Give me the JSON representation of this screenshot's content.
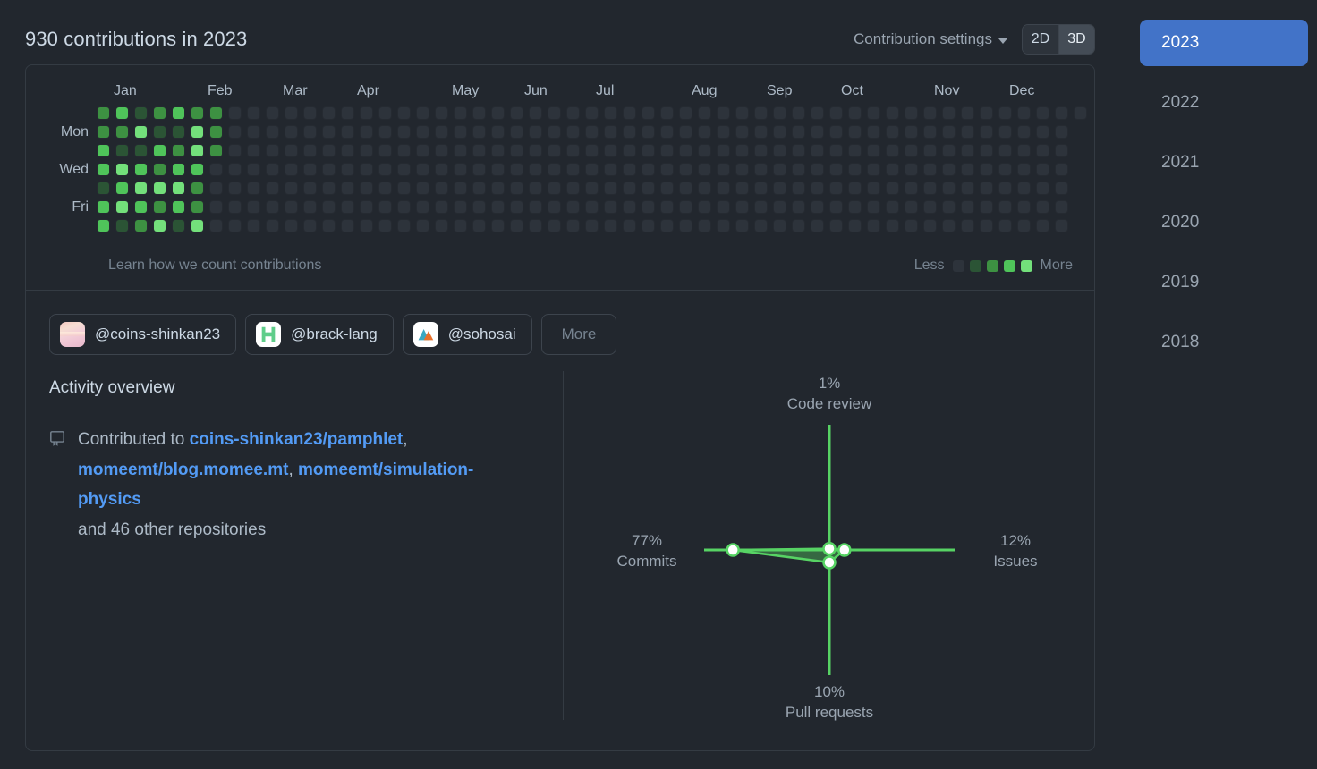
{
  "header": {
    "title": "930 contributions in 2023",
    "contribution_settings_label": "Contribution settings",
    "caret_icon": "chevron-down-icon",
    "dimension_toggle": {
      "options": [
        "2D",
        "3D"
      ],
      "selected": "3D"
    }
  },
  "calendar": {
    "months": [
      "Jan",
      "Feb",
      "Mar",
      "Apr",
      "May",
      "Jun",
      "Jul",
      "Aug",
      "Sep",
      "Oct",
      "Nov",
      "Dec"
    ],
    "month_positions": [
      18,
      123,
      207,
      290,
      396,
      477,
      557,
      664,
      748,
      831,
      935,
      1019
    ],
    "day_labels": [
      {
        "label": "Mon",
        "row": 1
      },
      {
        "label": "Wed",
        "row": 3
      },
      {
        "label": "Fri",
        "row": 5
      }
    ],
    "learn_link": "Learn how we count contributions",
    "legend": {
      "less_label": "Less",
      "more_label": "More",
      "colors": [
        "#2d333b",
        "#2b5435",
        "#3d9142",
        "#4fc45a",
        "#73e07b"
      ]
    },
    "columns": 53,
    "rows": 7,
    "levels": [
      [
        2,
        3,
        1,
        2,
        3,
        2,
        2
      ],
      [
        2,
        2,
        4,
        1,
        1,
        4,
        2
      ],
      [
        3,
        1,
        1,
        3,
        2,
        4,
        2
      ],
      [
        3,
        4,
        3,
        2,
        3,
        3,
        0
      ],
      [
        1,
        3,
        4,
        4,
        4,
        2,
        0
      ],
      [
        3,
        4,
        3,
        2,
        3,
        2,
        0
      ],
      [
        3,
        1,
        2,
        4,
        1,
        4,
        0
      ]
    ]
  },
  "organizations": [
    {
      "name": "@coins-shinkan23",
      "avatar": "sunset-photo-avatar"
    },
    {
      "name": "@brack-lang",
      "avatar": "brack-h-logo-avatar"
    },
    {
      "name": "@sohosai",
      "avatar": "sohosai-mountain-logo-avatar"
    }
  ],
  "more_button_label": "More",
  "activity": {
    "title": "Activity overview",
    "icon": "repo-icon",
    "prefix": "Contributed to ",
    "repositories": [
      "coins-shinkan23/pamphlet",
      "momeemt/blog.momee.mt",
      "momeemt/simulation-physics"
    ],
    "suffix": "and 46 other repositories"
  },
  "chart_data": {
    "type": "radar",
    "title": "",
    "categories": [
      "Code review",
      "Issues",
      "Pull requests",
      "Commits"
    ],
    "values": [
      1,
      12,
      10,
      77
    ],
    "value_labels": [
      "1%",
      "12%",
      "10%",
      "77%"
    ],
    "axis_angles_deg": [
      90,
      0,
      270,
      180
    ],
    "max": 100,
    "axis_color": "#57d364",
    "fill_color": "#57d364",
    "point_color": "#ffffff",
    "grid": false,
    "legend": "none"
  },
  "years": [
    {
      "label": "2023",
      "active": true
    },
    {
      "label": "2022",
      "active": false
    },
    {
      "label": "2021",
      "active": false
    },
    {
      "label": "2020",
      "active": false
    },
    {
      "label": "2019",
      "active": false
    },
    {
      "label": "2018",
      "active": false
    }
  ]
}
